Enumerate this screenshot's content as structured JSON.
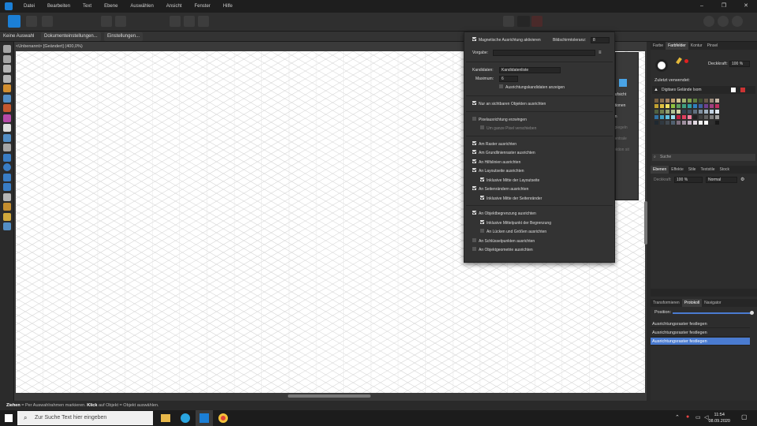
{
  "menubar": {
    "items": [
      "Datei",
      "Bearbeiten",
      "Text",
      "Ebene",
      "Auswählen",
      "Ansicht",
      "Fenster",
      "Hilfe"
    ],
    "window_controls": [
      "–",
      "❐",
      "✕"
    ]
  },
  "contextbar": {
    "no_selection": "Keine Auswahl",
    "doc_settings": "Dokumenteinstellungen...",
    "settings": "Einstellungen..."
  },
  "document": {
    "title": "<Unbenannt> [Geändert] (400,0%)"
  },
  "snapping": {
    "magnetic_label": "Magnetische Ausrichtung aktivieren",
    "magnetic_checked": true,
    "screen_tolerance_label": "Bildschirmtoleranz:",
    "screen_tolerance_value": "8",
    "preset_label": "Vorgabe:",
    "preset_value": "",
    "candidates_label": "Kandidaten:",
    "candidates_value": "Kandidatenliste",
    "maximum_label": "Maximum:",
    "maximum_value": "6",
    "show_candidates": "Ausrichtungskandidaten anzeigen",
    "options": [
      {
        "label": "Nur an sichtbaren Objekten ausrichten",
        "checked": true,
        "indent": 0,
        "dim": false
      },
      {
        "label": "Pixelausrichtung erzwingen",
        "checked": false,
        "indent": 0,
        "dim": false
      },
      {
        "label": "Um ganze Pixel verschieben",
        "checked": false,
        "indent": 1,
        "dim": true
      },
      {
        "label": "Am Raster ausrichten",
        "checked": true,
        "indent": 0,
        "dim": false
      },
      {
        "label": "Am Grundlinienraster ausrichten",
        "checked": true,
        "indent": 0,
        "dim": false
      },
      {
        "label": "An Hilfslinien ausrichten",
        "checked": true,
        "indent": 0,
        "dim": false
      },
      {
        "label": "An Layoutseite ausrichten",
        "checked": true,
        "indent": 0,
        "dim": false
      },
      {
        "label": "Inklusive Mitte der Layoutseite",
        "checked": true,
        "indent": 1,
        "dim": false
      },
      {
        "label": "An Seitenrändern ausrichten",
        "checked": true,
        "indent": 0,
        "dim": false
      },
      {
        "label": "Inklusive Mitte der Seitenränder",
        "checked": true,
        "indent": 1,
        "dim": false
      },
      {
        "label": "An Objektbegrenzung ausrichten",
        "checked": true,
        "indent": 0,
        "dim": false
      },
      {
        "label": "Inklusive Mittelpunkt der Begrenzung",
        "checked": true,
        "indent": 1,
        "dim": false
      },
      {
        "label": "An Lücken und Größen ausrichten",
        "checked": false,
        "indent": 1,
        "dim": false
      },
      {
        "label": "An Schlüsselpunkten ausrichten",
        "checked": false,
        "indent": 0,
        "dim": false
      },
      {
        "label": "An Objektgeometrie ausrichten",
        "checked": false,
        "indent": 0,
        "dim": false
      }
    ]
  },
  "studio_under": {
    "texts": [
      "aufsicht",
      "ptionen",
      "en",
      "spiegeln",
      "zentrale",
      "jektion sit"
    ]
  },
  "color_panel": {
    "tabs": [
      "Farbe",
      "Farbfelder",
      "Kontur",
      "Pinsel"
    ],
    "active_tab": "Farbfelder",
    "opacity_label": "Deckkraft:",
    "opacity_value": "100 %",
    "recent_label": "Zuletzt verwendet:",
    "palette_name": "Digitaes Gelände Isom",
    "search_placeholder": "Suche"
  },
  "layers_panel": {
    "tabs": [
      "Ebenen",
      "Effekte",
      "Stile",
      "Textstile",
      "Stock"
    ],
    "active_tab": "Ebenen",
    "opacity": "100 %",
    "blend": "Normal"
  },
  "history_panel": {
    "tabs": [
      "Transformieren",
      "Protokoll",
      "Navigator"
    ],
    "active_tab": "Protokoll",
    "position_label": "Position:",
    "entries": [
      "Ausrichtungsraster festlegen",
      "Ausrichtungsraster festlegen",
      "Ausrichtungsraster festlegen"
    ],
    "selected_index": 2
  },
  "status": {
    "bold1": "Ziehen",
    "text1": " = Per Auswahlrahmen markieren. ",
    "bold2": "Klick",
    "text2": " auf Objekt = Objekt auswählen."
  },
  "taskbar": {
    "search_placeholder": "Zur Suche Text hier eingeben",
    "time": "11:54",
    "date": "08.09.2020"
  },
  "colors": {
    "accent": "#1b7fd6",
    "selection": "#4a7bd0",
    "popup_bg": "#333333",
    "canvas": "#ffffff"
  }
}
